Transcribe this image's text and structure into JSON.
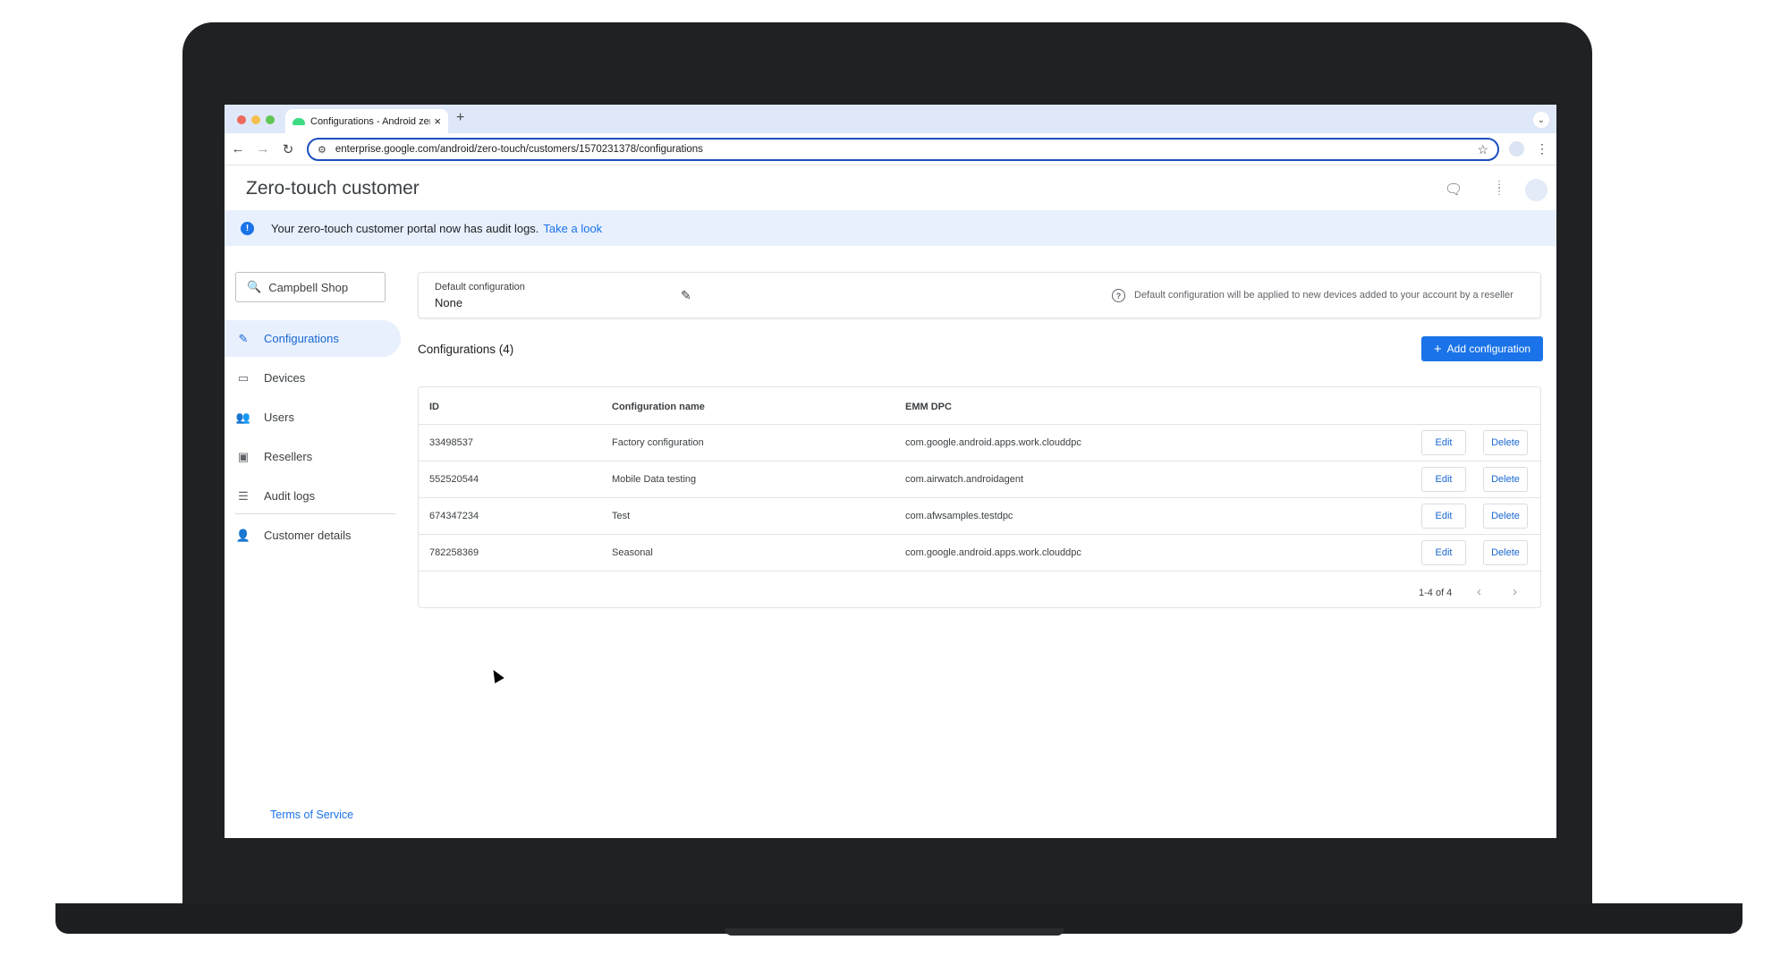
{
  "browser": {
    "tab_title": "Configurations - Android zero",
    "tab_close": "×",
    "new_tab": "+",
    "chevron": "⌄",
    "back": "←",
    "forward": "→",
    "reload": "↻",
    "url": "enterprise.google.com/android/zero-touch/customers/1570231378/configurations",
    "site_info": "⚙",
    "bookmark": "☆",
    "menu": "⋮"
  },
  "header": {
    "title": "Zero-touch customer",
    "feedback_icon": "🗨",
    "apps_icon": "⋮⋮⋮"
  },
  "banner": {
    "info_icon": "!",
    "text": "Your zero-touch customer portal now has audit logs.",
    "link": "Take a look"
  },
  "sidebar": {
    "search_icon": "🔍",
    "search_value": "Campbell Shop",
    "items": [
      {
        "label": "Configurations",
        "icon": "✎"
      },
      {
        "label": "Devices",
        "icon": "▭"
      },
      {
        "label": "Users",
        "icon": "👥"
      },
      {
        "label": "Resellers",
        "icon": "▣"
      },
      {
        "label": "Audit logs",
        "icon": "☰"
      },
      {
        "label": "Customer details",
        "icon": "👤"
      }
    ],
    "footer_link": "Terms of Service"
  },
  "default_config": {
    "label": "Default configuration",
    "value": "None",
    "edit_icon": "✎",
    "help_icon": "?",
    "help_text": "Default configuration will be applied to new devices added to your account by a reseller"
  },
  "configurations": {
    "heading": "Configurations (4)",
    "add_plus": "+",
    "add_label": "Add configuration",
    "columns": [
      "ID",
      "Configuration name",
      "EMM DPC"
    ],
    "rows": [
      {
        "id": "33498537",
        "name": "Factory configuration",
        "dpc": "com.google.android.apps.work.clouddpc",
        "edit": "Edit",
        "delete": "Delete"
      },
      {
        "id": "552520544",
        "name": "Mobile Data testing",
        "dpc": "com.airwatch.androidagent",
        "edit": "Edit",
        "delete": "Delete"
      },
      {
        "id": "674347234",
        "name": "Test",
        "dpc": "com.afwsamples.testdpc",
        "edit": "Edit",
        "delete": "Delete"
      },
      {
        "id": "782258369",
        "name": "Seasonal",
        "dpc": "com.google.android.apps.work.clouddpc",
        "edit": "Edit",
        "delete": "Delete"
      }
    ],
    "pagination": "1-4 of 4",
    "prev": "‹",
    "next": "›"
  },
  "colors": {
    "accent": "#1a73e8",
    "banner_bg": "#e8f0fe",
    "tabbar_bg": "#dfe8f8"
  }
}
